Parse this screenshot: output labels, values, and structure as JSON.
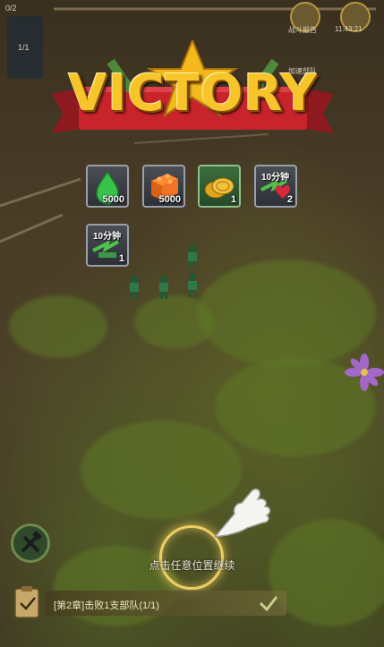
{
  "hud": {
    "top_counter": "0/2",
    "unit_count": "1/1",
    "top_right_label_1": "战斗报告",
    "top_right_time": "11:43:21",
    "top_right_label_2": "加速部队"
  },
  "banner": {
    "title": "VICTORY"
  },
  "rewards": [
    {
      "icon": "green-drop-icon",
      "count": "5000"
    },
    {
      "icon": "orange-brick-icon",
      "count": "5000"
    },
    {
      "icon": "gold-coins-icon",
      "count": "1"
    },
    {
      "icon": "speedup-heart-icon",
      "count": "2",
      "badge": "10分钟"
    },
    {
      "icon": "speedup-build-icon",
      "count": "1",
      "badge": "10分钟"
    }
  ],
  "prompt": {
    "continue": "点击任意位置继续"
  },
  "mission": {
    "text": "[第2章]击败1支部队(1/1)"
  },
  "colors": {
    "banner_red": "#c8242b",
    "victory_gold": "#f3b81c",
    "ring_gold": "#ffd86e"
  }
}
